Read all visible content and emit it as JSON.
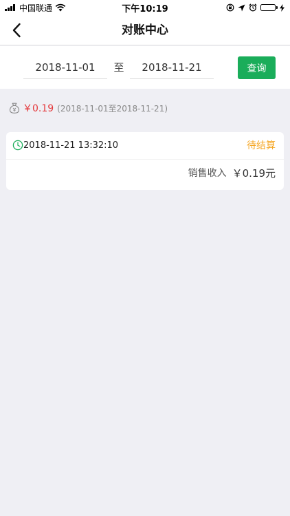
{
  "status_bar": {
    "carrier": "中国联通",
    "time": "下午10:19",
    "battery_level": 1.0,
    "icons": [
      "signal-icon",
      "wifi-icon",
      "rotation-lock-icon",
      "location-icon",
      "alarm-icon",
      "battery-icon",
      "charging-icon"
    ]
  },
  "nav": {
    "title": "对账中心",
    "back_icon": "back-chevron-icon"
  },
  "filter": {
    "start_date": "2018-11-01",
    "to_label": "至",
    "end_date": "2018-11-21",
    "query_label": "查询"
  },
  "summary": {
    "icon": "money-bag-icon",
    "total": "￥0.19",
    "range": "(2018-11-01至2018-11-21)"
  },
  "records": [
    {
      "time_icon": "clock-icon",
      "time": "2018-11-21 13:32:10",
      "status": "待结算",
      "label": "销售收入",
      "amount": "￥0.19元"
    }
  ],
  "colors": {
    "accent_green": "#1aad5a",
    "amount_red": "#e4393c",
    "status_orange": "#f5a623",
    "background": "#efeff4"
  }
}
